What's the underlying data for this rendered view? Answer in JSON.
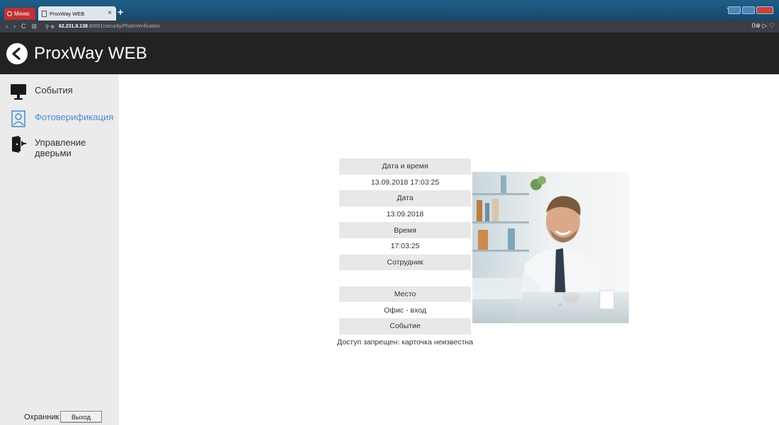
{
  "browser": {
    "menu_label": "Меню",
    "tab_title": "ProxWay WEB",
    "tab_close": "×",
    "new_tab": "+",
    "url_host": "62.231.8.138",
    "url_path": ":40001/security/PhotoVerification",
    "nav_back": "‹",
    "nav_forward": "›",
    "nav_reload": "C",
    "right_icons": "0⊗ ▷ ♡"
  },
  "app": {
    "title": "ProxWay WEB"
  },
  "sidebar": {
    "items": [
      {
        "label": "События",
        "icon": "monitor-icon",
        "active": false
      },
      {
        "label": "Фотоверификация",
        "icon": "person-photo-icon",
        "active": true
      },
      {
        "label": "Управление дверьми",
        "icon": "door-icon",
        "active": false
      }
    ],
    "footer": {
      "user": "Охранник",
      "logout_label": "Выход"
    }
  },
  "event": {
    "datetime_label": "Дата и время",
    "datetime_value": "13.09.2018 17:03:25",
    "date_label": "Дата",
    "date_value": "13.09.2018",
    "time_label": "Время",
    "time_value": "17:03:25",
    "employee_label": "Сотрудник",
    "employee_value": "",
    "place_label": "Место",
    "place_value": "Офис - вход",
    "event_label": "Событие",
    "event_value": "Доступ запрещен: карточка неизвестна"
  },
  "colors": {
    "header_bg": "#222222",
    "sidebar_bg": "#ebebeb",
    "active_item": "#4a90d9",
    "label_cell_bg": "#e8e8e8"
  }
}
